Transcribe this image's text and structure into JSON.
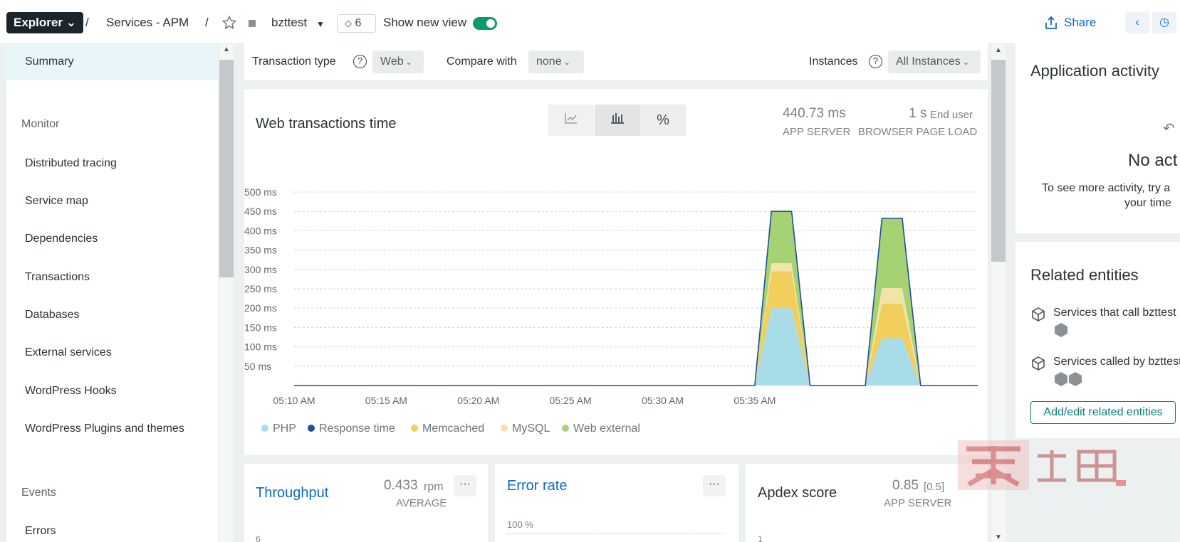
{
  "topbar": {
    "explorer_label": "Explorer ⌄",
    "sep1": "/",
    "breadcrumb_service": "Services - APM",
    "sep2": "/",
    "entity_name": "bzttest",
    "tag_count": "6",
    "show_new_view_label": "Show new view",
    "share_label": "Share"
  },
  "sidebar": {
    "summary": "Summary",
    "monitor_heading": "Monitor",
    "items": [
      "Distributed tracing",
      "Service map",
      "Dependencies",
      "Transactions",
      "Databases",
      "External services",
      "WordPress Hooks",
      "WordPress Plugins and themes"
    ],
    "events_heading": "Events",
    "errors": "Errors"
  },
  "filters": {
    "transaction_type_label": "Transaction type",
    "transaction_type_value": "Web",
    "compare_with_label": "Compare with",
    "compare_with_value": "none",
    "instances_label": "Instances",
    "instances_value": "All Instances"
  },
  "web_chart": {
    "title": "Web transactions time",
    "view_percent": "%",
    "app_server_value": "440.73 ms",
    "app_server_label": "APP SERVER",
    "browser_value": "1 s",
    "browser_end_user": "End user",
    "browser_label": "BROWSER PAGE LOAD"
  },
  "chart_data": {
    "type": "area",
    "stacked": true,
    "x": [
      "05:10 AM",
      "05:15 AM",
      "05:20 AM",
      "05:25 AM",
      "05:30 AM",
      "05:35 AM"
    ],
    "y_ticks": [
      "500 ms",
      "450 ms",
      "400 ms",
      "350 ms",
      "300 ms",
      "250 ms",
      "200 ms",
      "150 ms",
      "100 ms",
      "50 ms"
    ],
    "ylim": [
      0,
      500
    ],
    "grid": true,
    "legend_position": "bottom",
    "time_points_min": [
      0,
      25,
      25.9,
      27,
      28,
      31,
      31.9,
      33,
      34,
      37.1
    ],
    "series": [
      {
        "name": "PHP",
        "color": "#a8dce8",
        "values": [
          0,
          0,
          200,
          200,
          0,
          0,
          122,
          122,
          0,
          0
        ]
      },
      {
        "name": "Memcached",
        "color": "#f2ce5c",
        "values": [
          0,
          0,
          95,
          95,
          0,
          0,
          90,
          90,
          0,
          0
        ]
      },
      {
        "name": "MySQL",
        "color": "#f2e3a8",
        "values": [
          0,
          0,
          21,
          21,
          0,
          0,
          40,
          40,
          0,
          0
        ]
      },
      {
        "name": "Web external",
        "color": "#a5d273",
        "values": [
          0,
          0,
          134,
          134,
          0,
          0,
          180,
          180,
          0,
          0
        ]
      }
    ],
    "line_series": {
      "name": "Response time",
      "color": "#1c4ea1",
      "values": [
        0,
        0,
        450,
        450,
        0,
        0,
        432,
        432,
        0,
        0
      ]
    }
  },
  "legend": [
    "PHP",
    "Response time",
    "Memcached",
    "MySQL",
    "Web external"
  ],
  "legend_colors": [
    "#a8dce8",
    "#1c4ea1",
    "#f2ce5c",
    "#f2e3a8",
    "#a5d273"
  ],
  "throughput": {
    "title": "Throughput",
    "value": "0.433",
    "unit": "rpm",
    "label": "AVERAGE",
    "axis_top": "6"
  },
  "error_rate": {
    "title": "Error rate",
    "axis_top": "100 %"
  },
  "apdex": {
    "title": "Apdex score",
    "value": "0.85",
    "threshold": "[0.5]",
    "label": "APP SERVER",
    "axis_top": "1"
  },
  "activity": {
    "title": "Application activity",
    "no_activity": "No act",
    "hint_line1": "To see more activity, try a",
    "hint_line2": "your time"
  },
  "related": {
    "title": "Related entities",
    "calls_label": "Services that call bzttest",
    "called_by_label": "Services called by bzttest",
    "add_edit_label": "Add/edit related entities"
  },
  "ellipsis": "···"
}
